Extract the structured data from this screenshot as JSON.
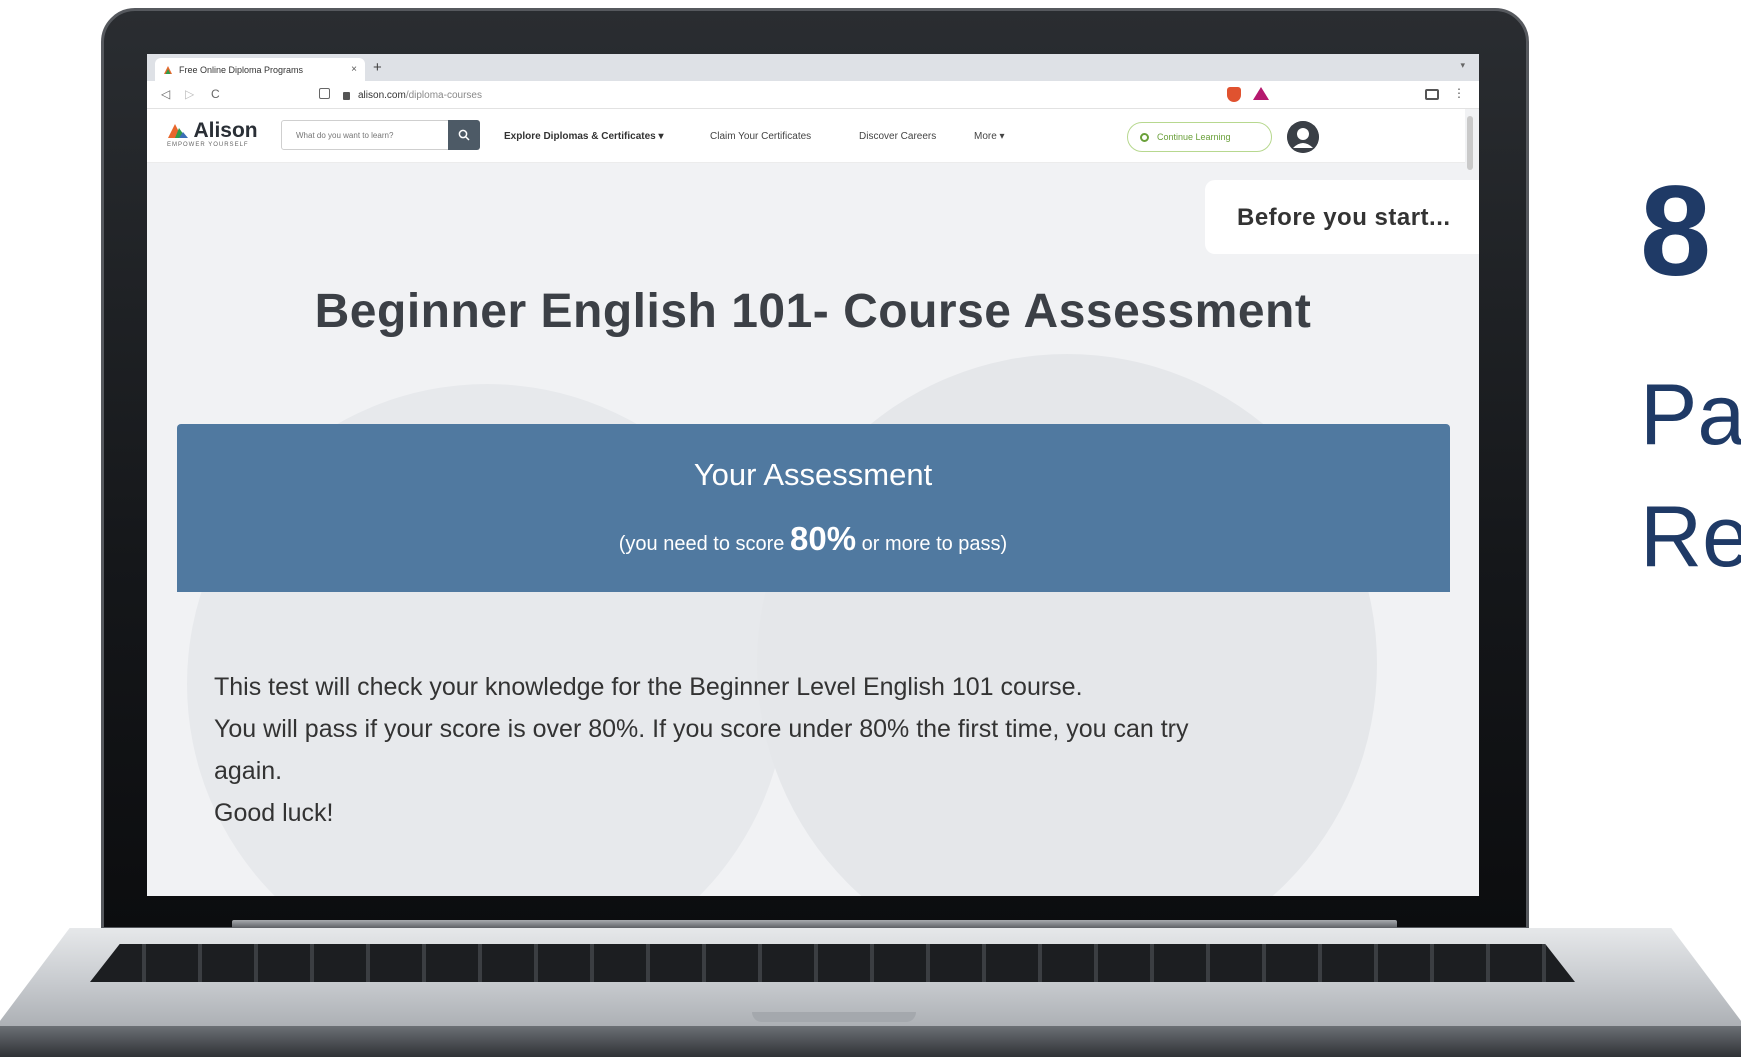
{
  "browser": {
    "tab_title": "Free Online Diploma Programs",
    "tab_close": "×",
    "new_tab": "+",
    "url_domain": "alison.com",
    "url_path": "/diploma-courses",
    "back": "◁",
    "forward": "▷",
    "reload": "C",
    "menu": "⋮"
  },
  "header": {
    "logo_text": "Alison",
    "logo_tagline": "EMPOWER YOURSELF",
    "search_placeholder": "What do you want to learn?",
    "nav": {
      "explore": "Explore Diplomas & Certificates ▾",
      "claim": "Claim Your Certificates",
      "careers": "Discover Careers",
      "more": "More ▾"
    },
    "continue_label": "Continue Learning"
  },
  "main": {
    "before_start": "Before you start...",
    "course_title": "Beginner English 101- Course Assessment",
    "assessment_heading": "Your Assessment",
    "pass_prefix": "(you need to score",
    "pass_score": "80%",
    "pass_suffix": "or more to pass)",
    "instructions": [
      "This test will check your knowledge for the Beginner Level English 101 course.",
      "You will pass if your score is over 80%. If you score under 80% the first time, you can try",
      "again.",
      "Good luck!"
    ]
  },
  "slide": {
    "number": "8",
    "line1": "Pa",
    "line2": "Re"
  },
  "colors": {
    "assessment_bar": "#5079a0",
    "slide_text": "#1f3a66",
    "continue_accent": "#6aa03a"
  }
}
